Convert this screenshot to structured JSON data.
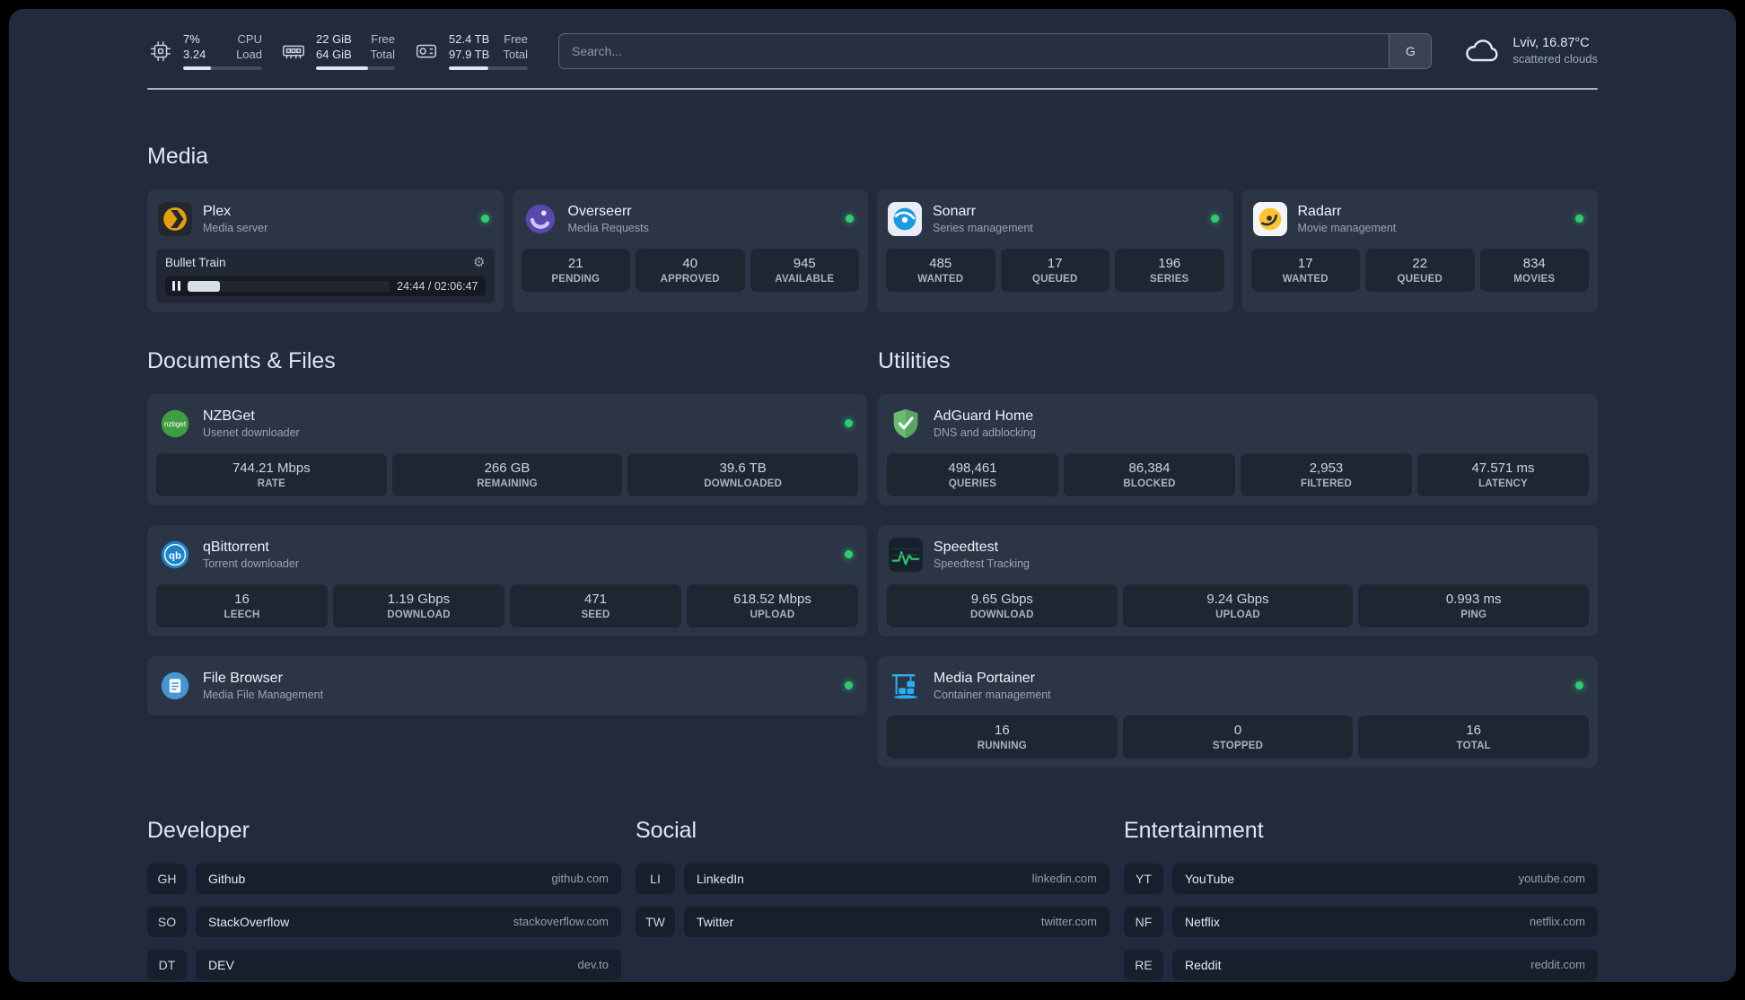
{
  "theme": {
    "background": "#212b3d",
    "card_background": "#2b3547",
    "tile_background": "#1b2433",
    "text_primary": "#e2e8f0",
    "text_secondary": "#97a3b4",
    "status_online": "#2ecc71",
    "plex_accent": "#e5a00d",
    "adguard_accent": "#68bc71",
    "portainer_accent": "#29aef5",
    "speedtest_accent": "#2fbf71"
  },
  "header": {
    "resources": [
      {
        "icon": "cpu-icon",
        "value_top": "7%",
        "label_top": "CPU",
        "value_bottom": "3.24",
        "label_bottom": "Load",
        "progress_pct": 35
      },
      {
        "icon": "memory-icon",
        "value_top": "22 GiB",
        "label_top": "Free",
        "value_bottom": "64 GiB",
        "label_bottom": "Total",
        "progress_pct": 66
      },
      {
        "icon": "disk-icon",
        "value_top": "52.4 TB",
        "label_top": "Free",
        "value_bottom": "97.9 TB",
        "label_bottom": "Total",
        "progress_pct": 50
      }
    ],
    "search": {
      "placeholder": "Search...",
      "button_label": "G"
    },
    "weather": {
      "location": "Lviv, 16.87°C",
      "condition": "scattered clouds"
    }
  },
  "media": {
    "title": "Media",
    "plex": {
      "name": "Plex",
      "desc": "Media server",
      "online": true,
      "now_playing": {
        "title": "Bullet Train",
        "time": "24:44 / 02:06:47",
        "progress_pct": 16
      }
    },
    "cards": [
      {
        "name": "Overseerr",
        "desc": "Media Requests",
        "online": true,
        "stats": [
          {
            "value": "21",
            "label": "PENDING"
          },
          {
            "value": "40",
            "label": "APPROVED"
          },
          {
            "value": "945",
            "label": "AVAILABLE"
          }
        ]
      },
      {
        "name": "Sonarr",
        "desc": "Series management",
        "online": true,
        "stats": [
          {
            "value": "485",
            "label": "WANTED"
          },
          {
            "value": "17",
            "label": "QUEUED"
          },
          {
            "value": "196",
            "label": "SERIES"
          }
        ]
      },
      {
        "name": "Radarr",
        "desc": "Movie management",
        "online": true,
        "stats": [
          {
            "value": "17",
            "label": "WANTED"
          },
          {
            "value": "22",
            "label": "QUEUED"
          },
          {
            "value": "834",
            "label": "MOVIES"
          }
        ]
      }
    ]
  },
  "documents": {
    "title": "Documents & Files",
    "cards": [
      {
        "name": "NZBGet",
        "desc": "Usenet downloader",
        "online": true,
        "stats": [
          {
            "value": "744.21 Mbps",
            "label": "RATE"
          },
          {
            "value": "266 GB",
            "label": "REMAINING"
          },
          {
            "value": "39.6 TB",
            "label": "DOWNLOADED"
          }
        ]
      },
      {
        "name": "qBittorrent",
        "desc": "Torrent downloader",
        "online": true,
        "stats": [
          {
            "value": "16",
            "label": "LEECH"
          },
          {
            "value": "1.19 Gbps",
            "label": "DOWNLOAD"
          },
          {
            "value": "471",
            "label": "SEED"
          },
          {
            "value": "618.52 Mbps",
            "label": "UPLOAD"
          }
        ]
      },
      {
        "name": "File Browser",
        "desc": "Media File Management",
        "online": true,
        "stats": []
      }
    ]
  },
  "utilities": {
    "title": "Utilities",
    "cards": [
      {
        "name": "AdGuard Home",
        "desc": "DNS and adblocking",
        "online": false,
        "stats": [
          {
            "value": "498,461",
            "label": "QUERIES"
          },
          {
            "value": "86,384",
            "label": "BLOCKED"
          },
          {
            "value": "2,953",
            "label": "FILTERED"
          },
          {
            "value": "47.571 ms",
            "label": "LATENCY"
          }
        ]
      },
      {
        "name": "Speedtest",
        "desc": "Speedtest Tracking",
        "online": false,
        "stats": [
          {
            "value": "9.65 Gbps",
            "label": "DOWNLOAD"
          },
          {
            "value": "9.24 Gbps",
            "label": "UPLOAD"
          },
          {
            "value": "0.993 ms",
            "label": "PING"
          }
        ]
      },
      {
        "name": "Media Portainer",
        "desc": "Container management",
        "online": true,
        "stats": [
          {
            "value": "16",
            "label": "RUNNING"
          },
          {
            "value": "0",
            "label": "STOPPED"
          },
          {
            "value": "16",
            "label": "TOTAL"
          }
        ]
      }
    ]
  },
  "bookmarks": [
    {
      "title": "Developer",
      "items": [
        {
          "abbr": "GH",
          "name": "Github",
          "url": "github.com"
        },
        {
          "abbr": "SO",
          "name": "StackOverflow",
          "url": "stackoverflow.com"
        },
        {
          "abbr": "DT",
          "name": "DEV",
          "url": "dev.to"
        }
      ]
    },
    {
      "title": "Social",
      "items": [
        {
          "abbr": "LI",
          "name": "LinkedIn",
          "url": "linkedin.com"
        },
        {
          "abbr": "TW",
          "name": "Twitter",
          "url": "twitter.com"
        }
      ]
    },
    {
      "title": "Entertainment",
      "items": [
        {
          "abbr": "YT",
          "name": "YouTube",
          "url": "youtube.com"
        },
        {
          "abbr": "NF",
          "name": "Netflix",
          "url": "netflix.com"
        },
        {
          "abbr": "RE",
          "name": "Reddit",
          "url": "reddit.com"
        }
      ]
    }
  ]
}
